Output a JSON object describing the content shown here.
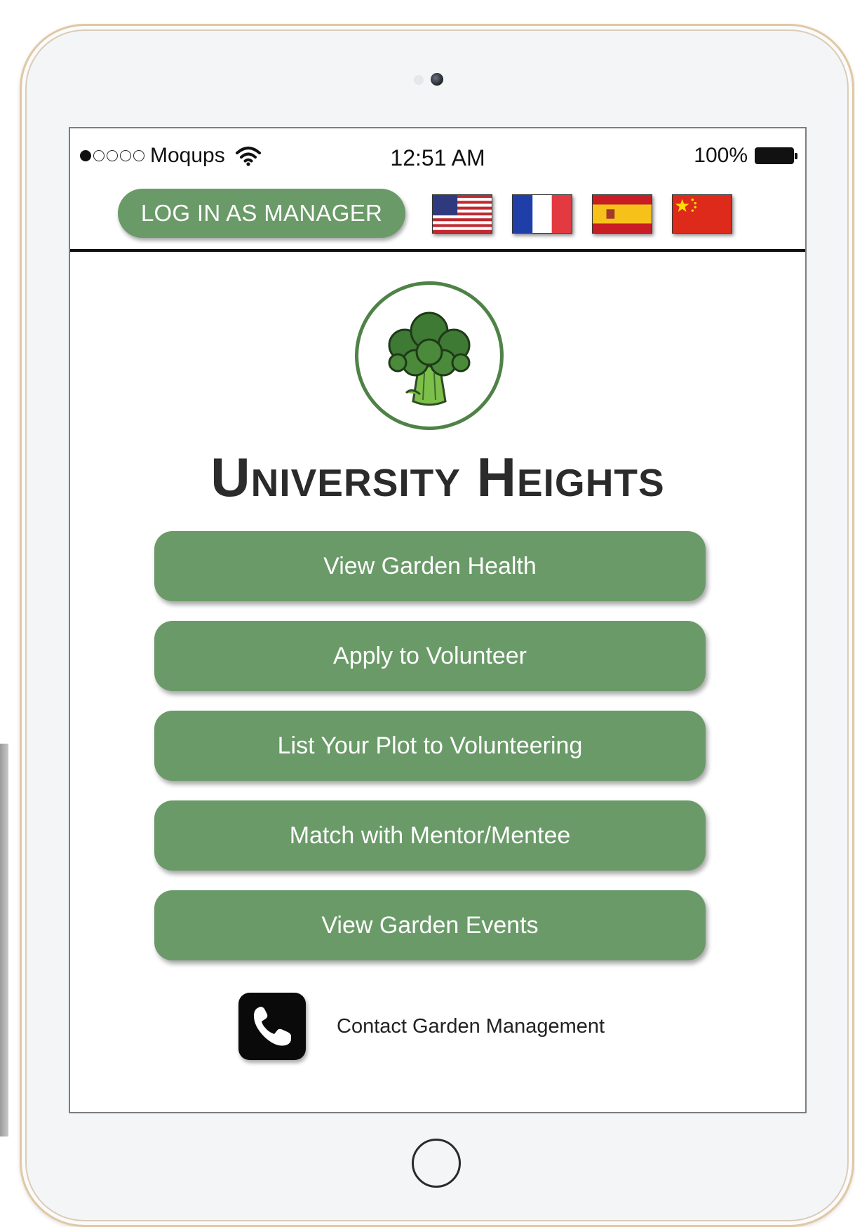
{
  "status_bar": {
    "carrier": "Moqups",
    "signal_dots_filled": 1,
    "signal_dots_total": 5,
    "time": "12:51 AM",
    "battery_percent": "100%"
  },
  "header": {
    "manager_login_label": "LOG IN AS MANAGER",
    "language_flags": [
      "us-flag-icon",
      "france-flag-icon",
      "spain-flag-icon",
      "china-flag-icon"
    ]
  },
  "brand": {
    "logo_icon": "broccoli-icon",
    "title": "University Heights"
  },
  "menu": {
    "items": [
      {
        "label": "View Garden Health"
      },
      {
        "label": "Apply to Volunteer"
      },
      {
        "label": "List Your Plot to Volunteering"
      },
      {
        "label": "Match with Mentor/Mentee"
      },
      {
        "label": "View Garden Events"
      }
    ]
  },
  "contact": {
    "icon": "phone-icon",
    "label": "Contact Garden Management"
  },
  "colors": {
    "button_green": "#6a9a68",
    "logo_ring_green": "#4f8247",
    "title_text": "#2b2b2b"
  }
}
